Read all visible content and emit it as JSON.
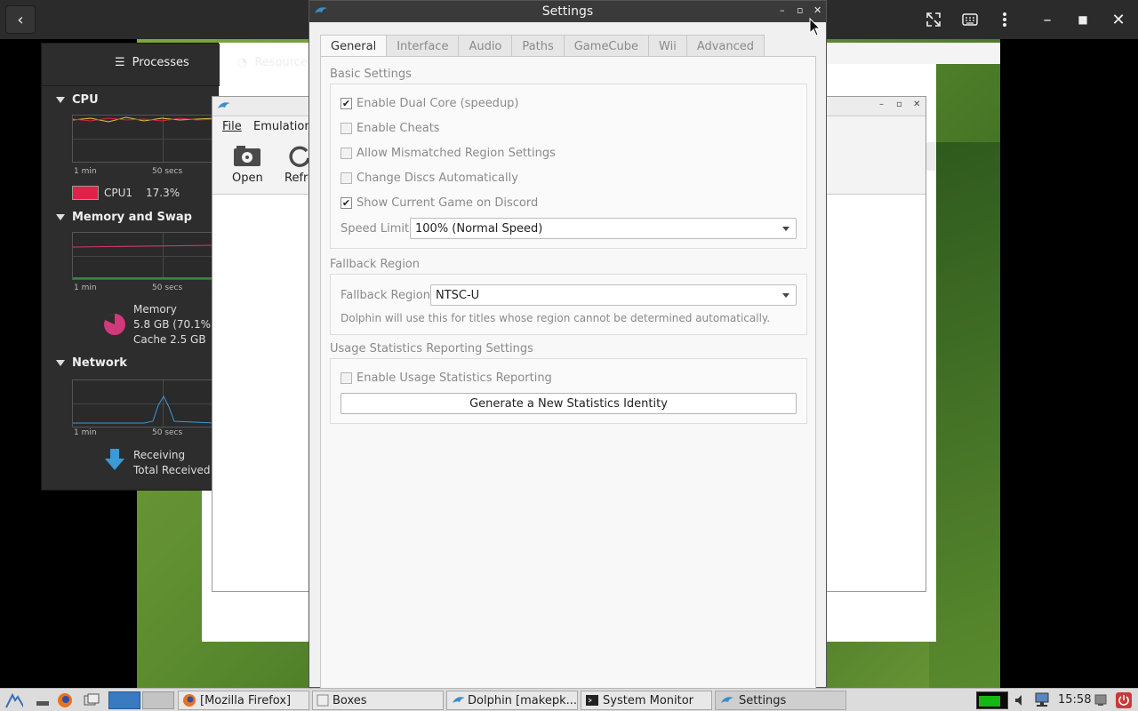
{
  "topbar": {
    "back_icon": "chevron-left-icon",
    "fullscreen_icon": "fullscreen-icon",
    "keyboard_icon": "keyboard-icon",
    "menu_icon": "kebab-menu-icon"
  },
  "sysmon": {
    "tabs": [
      {
        "label": "Processes",
        "icon": "list-icon"
      },
      {
        "label": "Resources",
        "icon": "gauge-icon"
      }
    ],
    "cpu": {
      "title": "CPU",
      "x_label_left": "1 min",
      "x_label_mid": "50 secs",
      "legend_name": "CPU1",
      "legend_value": "17.3%",
      "legend_color": "#e0224a"
    },
    "memory": {
      "title": "Memory and Swap",
      "x_label_left": "1 min",
      "x_label_mid": "50 secs",
      "label": "Memory",
      "value": "5.8 GB (70.1%",
      "cache": "Cache 2.5 GB",
      "pie_color": "#d2397a"
    },
    "network": {
      "title": "Network",
      "x_label_left": "1 min",
      "x_label_mid": "50 secs",
      "receiving": "Receiving",
      "total_received": "Total Received"
    }
  },
  "dolphin_main": {
    "menu": [
      "File",
      "Emulation"
    ],
    "toolbar": [
      {
        "label": "Open",
        "icon": "open-disc-icon"
      },
      {
        "label": "Refre",
        "icon": "refresh-icon"
      }
    ]
  },
  "settings": {
    "title": "Settings",
    "tabs": [
      "General",
      "Interface",
      "Audio",
      "Paths",
      "GameCube",
      "Wii",
      "Advanced"
    ],
    "active_tab": "General",
    "basic": {
      "title": "Basic Settings",
      "options": [
        {
          "label": "Enable Dual Core (speedup)",
          "checked": true
        },
        {
          "label": "Enable Cheats",
          "checked": false
        },
        {
          "label": "Allow Mismatched Region Settings",
          "checked": false
        },
        {
          "label": "Change Discs Automatically",
          "checked": false
        },
        {
          "label": "Show Current Game on Discord",
          "checked": true
        }
      ],
      "speed_limit_label": "Speed Limit:",
      "speed_limit_value": "100% (Normal Speed)"
    },
    "fallback": {
      "title": "Fallback Region",
      "label": "Fallback Region:",
      "value": "NTSC-U",
      "note": "Dolphin will use this for titles whose region cannot be determined automatically."
    },
    "usage": {
      "title": "Usage Statistics Reporting Settings",
      "option": {
        "label": "Enable Usage Statistics Reporting",
        "checked": false
      },
      "button": "Generate a New Statistics Identity"
    }
  },
  "taskbar": {
    "items": [
      {
        "label": "[Mozilla Firefox]",
        "icon": "firefox-icon"
      },
      {
        "label": "Boxes",
        "icon": "boxes-icon"
      },
      {
        "label": "Dolphin [makepk...",
        "icon": "dolphin-icon"
      },
      {
        "label": "System Monitor",
        "icon": "terminal-icon"
      },
      {
        "label": "Settings",
        "icon": "dolphin-icon"
      }
    ],
    "clock": "15:58"
  }
}
